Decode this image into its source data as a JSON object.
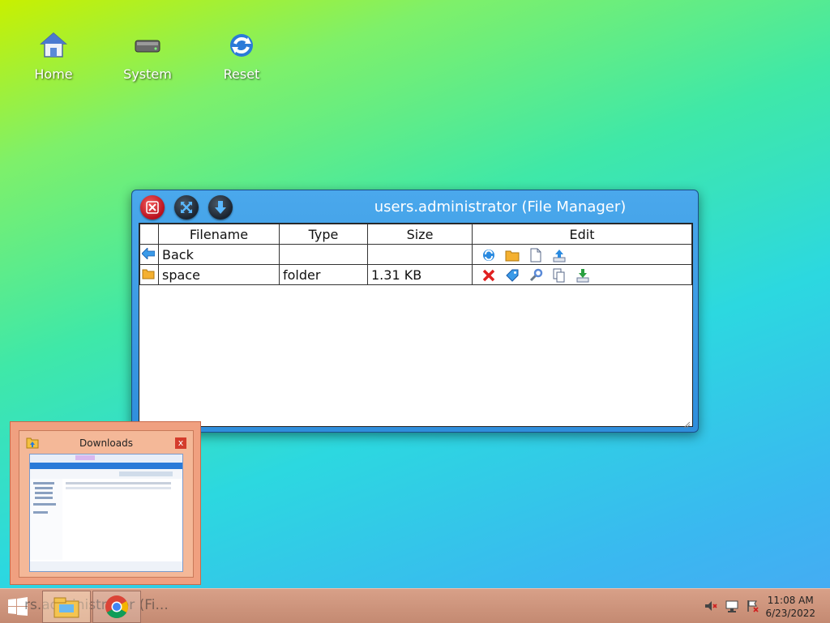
{
  "desktop": {
    "icons": [
      {
        "label": "Home"
      },
      {
        "label": "System"
      },
      {
        "label": "Reset"
      }
    ]
  },
  "window": {
    "title": "users.administrator (File Manager)",
    "columns": {
      "filename": "Filename",
      "type": "Type",
      "size": "Size",
      "edit": "Edit"
    },
    "rows": [
      {
        "name": "Back",
        "type": "",
        "size": ""
      },
      {
        "name": "space",
        "type": "folder",
        "size": "1.31 KB"
      }
    ]
  },
  "thumbnail": {
    "title": "Downloads",
    "close_glyph": "x"
  },
  "taskbar": {
    "hidden_text": "rs.administrator (Fi..."
  },
  "clock": {
    "time": "11:08 AM",
    "date": "6/23/2022"
  },
  "colors": {
    "accent": "#2f8edc",
    "close_red": "#b8101e",
    "taskbar": "#c48a72"
  }
}
